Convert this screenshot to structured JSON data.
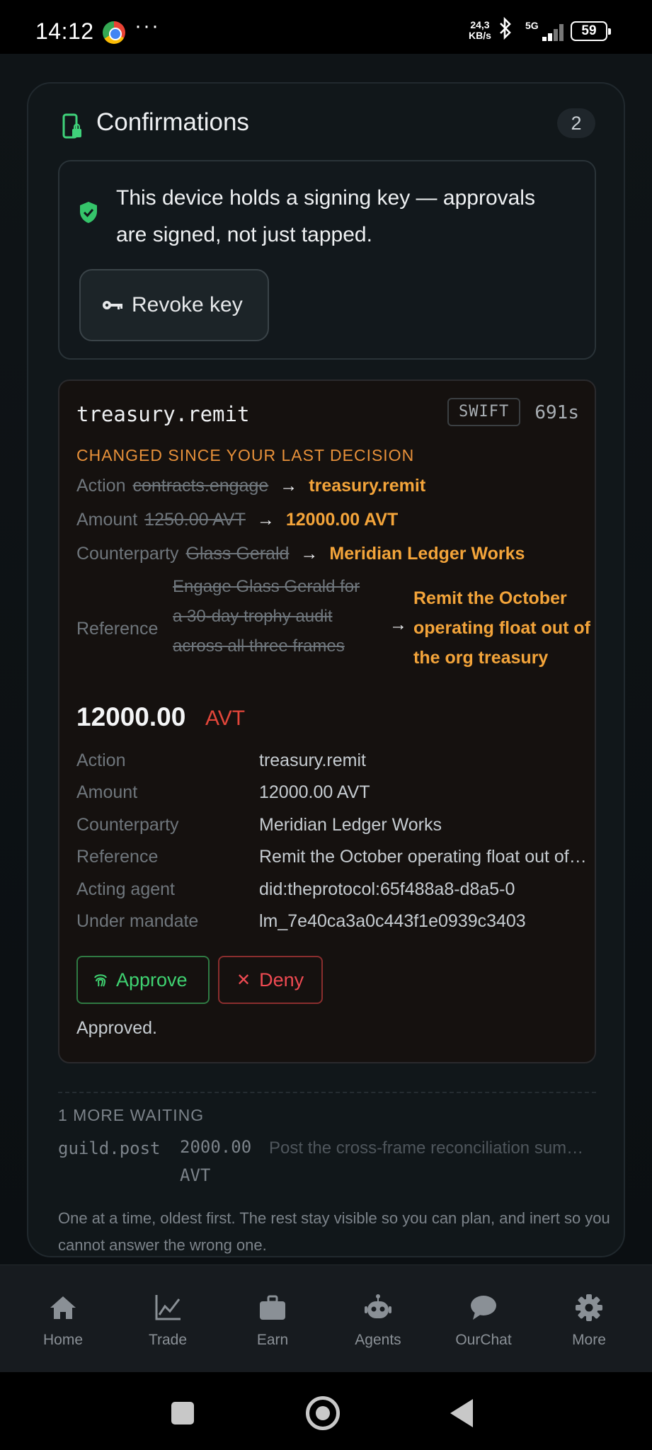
{
  "status_bar": {
    "time": "14:12",
    "more": "···",
    "speed_top": "24,3",
    "speed_unit": "KB/s",
    "network": "5G",
    "battery": "59"
  },
  "confirmations": {
    "title": "Confirmations",
    "count": "2",
    "signing_text": "This device holds a signing key — approvals are signed, not just tapped.",
    "revoke_label": "Revoke key"
  },
  "request": {
    "name": "treasury.remit",
    "tag": "SWIFT",
    "timer": "691s",
    "changed_notice": "CHANGED SINCE YOUR LAST DECISION",
    "diffs": [
      {
        "label": "Action",
        "old": "contracts.engage",
        "arrow": "→",
        "new": "treasury.remit"
      },
      {
        "label": "Amount",
        "old": "1250.00 AVT",
        "arrow": "→",
        "new": "12000.00 AVT"
      },
      {
        "label": "Counterparty",
        "old": "Glass Gerald",
        "arrow": "→",
        "new": "Meridian Ledger Works"
      }
    ],
    "reference_diff": {
      "label": "Reference",
      "old": "Engage Glass Gerald for a 30-day trophy audit across all three frames",
      "arrow": "→",
      "new": "Remit the October operating float out of the org treasury"
    },
    "amount_value": "12000.00",
    "amount_unit": "AVT",
    "details": [
      {
        "key": "Action",
        "value": "treasury.remit"
      },
      {
        "key": "Amount",
        "value": "12000.00 AVT"
      },
      {
        "key": "Counterparty",
        "value": "Meridian Ledger Works"
      },
      {
        "key": "Reference",
        "value": "Remit the October operating float out of the org treasury"
      },
      {
        "key": "Acting agent",
        "value": "did:theprotocol:65f488a8-d8a5-0"
      },
      {
        "key": "Under mandate",
        "value": "lm_7e40ca3a0c443f1e0939c3403"
      }
    ],
    "approve_label": "Approve",
    "deny_symbol": "✕",
    "deny_label": "Deny",
    "status_text": "Approved."
  },
  "queue": {
    "header": "1 MORE WAITING",
    "item_name": "guild.post",
    "item_amount": "2000.00 AVT",
    "item_desc": "Post the cross-frame reconciliation summary",
    "note": "One at a time, oldest first. The rest stay visible so you can plan, and inert so you cannot answer the wrong one."
  },
  "bottom_nav": [
    {
      "label": "Home",
      "icon": "home-icon"
    },
    {
      "label": "Trade",
      "icon": "chart-icon"
    },
    {
      "label": "Earn",
      "icon": "briefcase-icon"
    },
    {
      "label": "Agents",
      "icon": "robot-icon"
    },
    {
      "label": "OurChat",
      "icon": "chat-icon"
    },
    {
      "label": "More",
      "icon": "gear-icon"
    }
  ],
  "colors": {
    "accent_green": "#3fd271",
    "warning_orange": "#f3a43a",
    "deny_red": "#ef4a52"
  }
}
